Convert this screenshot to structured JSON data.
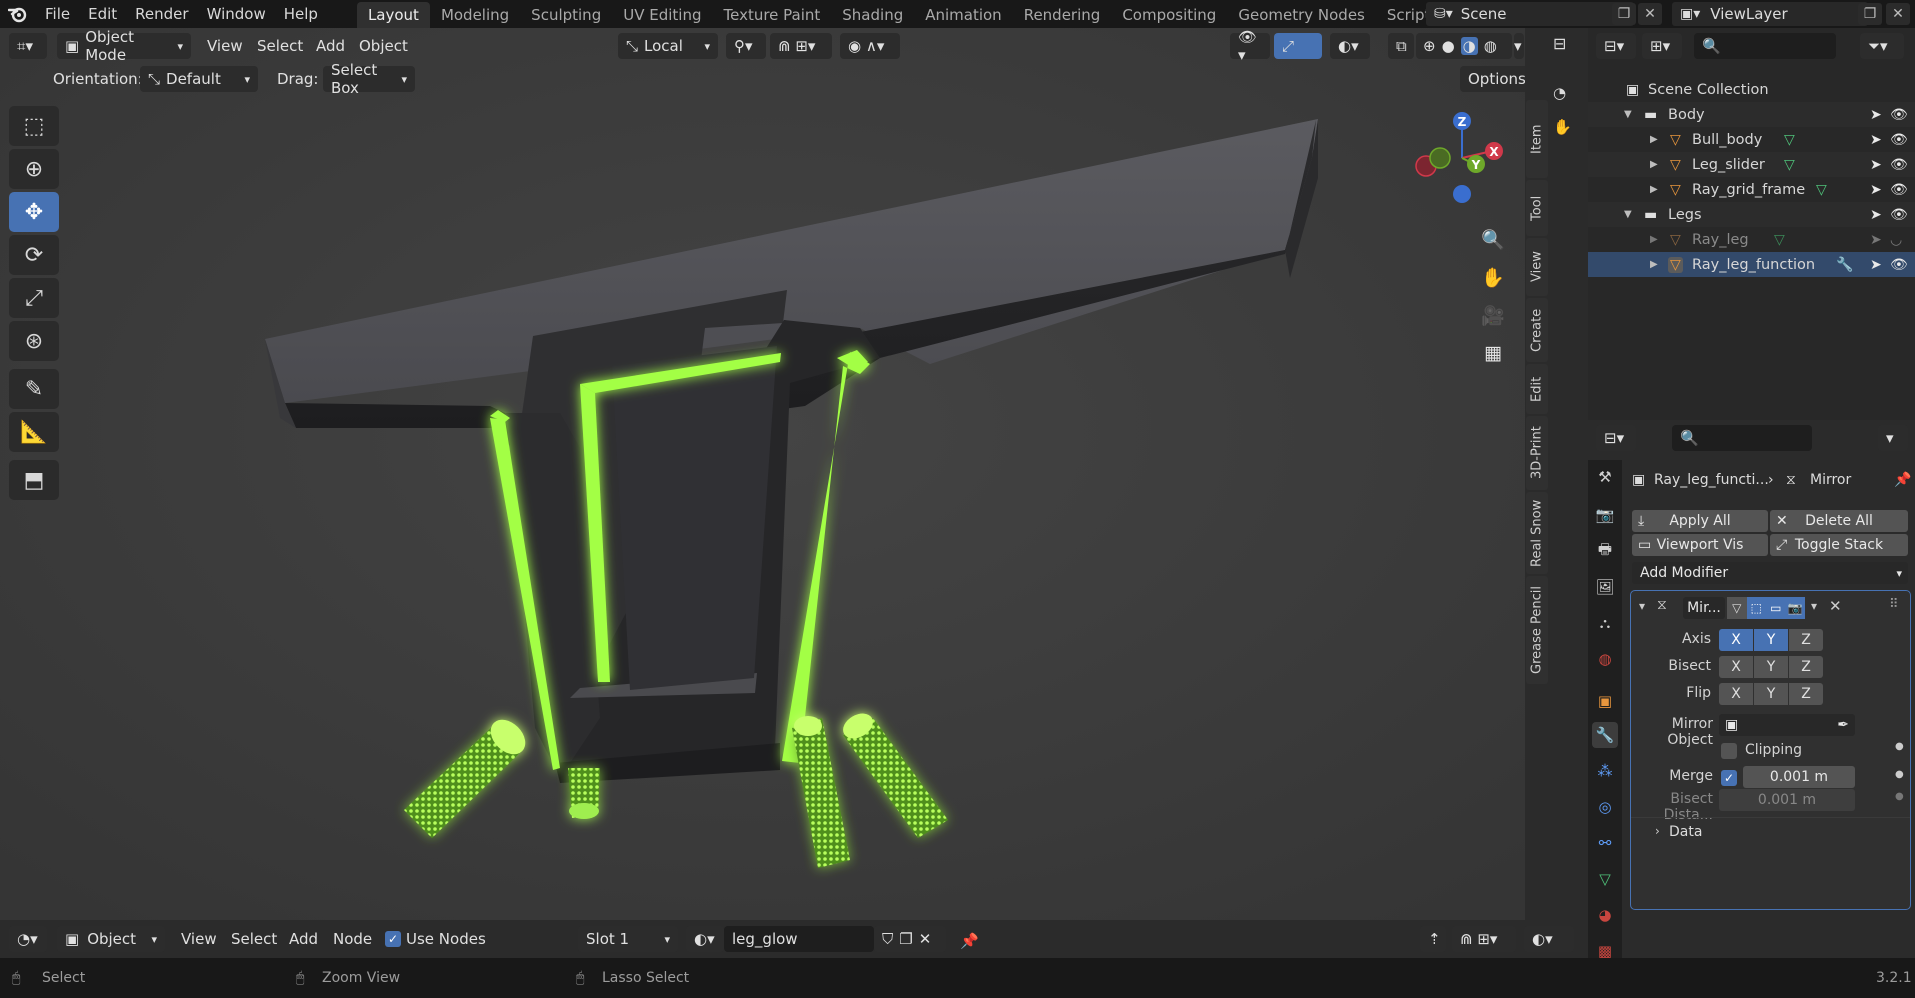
{
  "menu": [
    "File",
    "Edit",
    "Render",
    "Window",
    "Help"
  ],
  "workspaces": [
    "Layout",
    "Modeling",
    "Sculpting",
    "UV Editing",
    "Texture Paint",
    "Shading",
    "Animation",
    "Rendering",
    "Compositing",
    "Geometry Nodes",
    "Scripting"
  ],
  "active_workspace": "Layout",
  "scene": "Scene",
  "view_layer": "ViewLayer",
  "viewport": {
    "mode": "Object Mode",
    "menus": [
      "View",
      "Select",
      "Add",
      "Object"
    ],
    "transform_orientation": "Local",
    "orientation_label": "Orientation:",
    "orientation_value": "Default",
    "drag_label": "Drag:",
    "drag_value": "Select Box",
    "options": "Options",
    "side_tabs": [
      "Item",
      "Tool",
      "View",
      "Create",
      "Edit",
      "3D-Print",
      "Real Snow",
      "Grease Pencil"
    ],
    "gizmo_axes": [
      "Z",
      "X",
      "Y"
    ]
  },
  "bottom_header": {
    "editor": "Object",
    "menus": [
      "View",
      "Select",
      "Add",
      "Node"
    ],
    "use_nodes": "Use Nodes",
    "slot": "Slot 1",
    "material": "leg_glow"
  },
  "status": {
    "select": "Select",
    "zoom": "Zoom View",
    "lasso": "Lasso Select",
    "version": "3.2.1"
  },
  "outliner": {
    "root": "Scene Collection",
    "items": [
      {
        "name": "Body",
        "type": "collection"
      },
      {
        "name": "Bull_body",
        "type": "object"
      },
      {
        "name": "Leg_slider",
        "type": "object"
      },
      {
        "name": "Ray_grid_frame",
        "type": "object"
      },
      {
        "name": "Legs",
        "type": "collection"
      },
      {
        "name": "Ray_leg",
        "type": "object",
        "hidden": true
      },
      {
        "name": "Ray_leg_function",
        "type": "object"
      }
    ]
  },
  "properties": {
    "object_name": "Ray_leg_functi...",
    "modifier_name": "Mirror",
    "apply_all": "Apply All",
    "delete_all": "Delete All",
    "viewport_vis": "Viewport Vis",
    "toggle_stack": "Toggle Stack",
    "add_modifier": "Add Modifier",
    "modifier_short": "Mir...",
    "axis_label": "Axis",
    "bisect_label": "Bisect",
    "flip_label": "Flip",
    "axis_letters": [
      "X",
      "Y",
      "Z"
    ],
    "axis_on": [
      true,
      true,
      false
    ],
    "mirror_object_label": "Mirror Object",
    "clipping": "Clipping",
    "merge_label": "Merge",
    "merge_value": "0.001 m",
    "bisect_distance_label": "Bisect Dista...",
    "bisect_distance_value": "0.001 m",
    "data_panel": "Data"
  },
  "colors": {
    "accent": "#4772b3",
    "glow": "#9bff3d",
    "object_icon": "#e8963d",
    "mesh_icon": "#4fc37a"
  }
}
